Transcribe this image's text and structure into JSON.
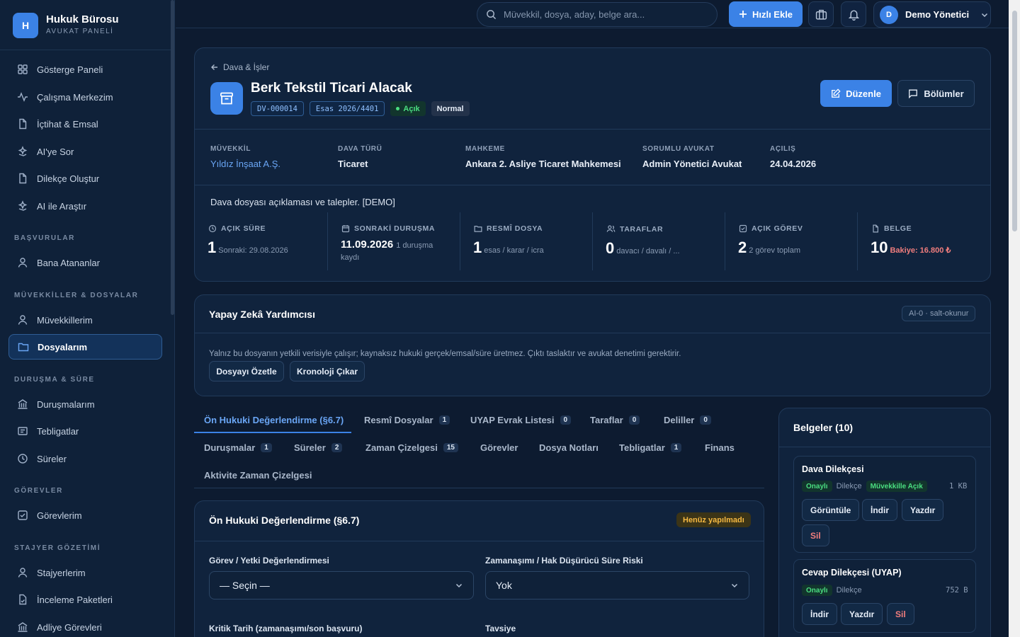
{
  "brand": {
    "logo": "H",
    "title": "Hukuk Bürosu",
    "subtitle": "AVUKAT PANELİ"
  },
  "sidebar": {
    "items": [
      {
        "label": "Gösterge Paneli",
        "icon": "grid-icon"
      },
      {
        "label": "Çalışma Merkezim",
        "icon": "activity-icon"
      },
      {
        "label": "İçtihat & Emsal",
        "icon": "file-icon"
      },
      {
        "label": "AI'ye Sor",
        "icon": "sparkle-icon"
      },
      {
        "label": "Dilekçe Oluştur",
        "icon": "file-icon"
      },
      {
        "label": "AI ile Araştır",
        "icon": "sparkle-icon"
      }
    ],
    "sections": [
      {
        "title": "BAŞVURULAR",
        "items": [
          {
            "label": "Bana Atananlar",
            "icon": "user-icon"
          }
        ]
      },
      {
        "title": "MÜVEKKİLLER & DOSYALAR",
        "items": [
          {
            "label": "Müvekkillerim",
            "icon": "user-icon"
          },
          {
            "label": "Dosyalarım",
            "icon": "folder-icon",
            "active": true
          }
        ]
      },
      {
        "title": "DURUŞMA & SÜRE",
        "items": [
          {
            "label": "Duruşmalarım",
            "icon": "courthouse-icon"
          },
          {
            "label": "Tebligatlar",
            "icon": "notice-icon"
          },
          {
            "label": "Süreler",
            "icon": "clock-icon"
          }
        ]
      },
      {
        "title": "GÖREVLER",
        "items": [
          {
            "label": "Görevlerim",
            "icon": "checkbox-icon"
          }
        ]
      },
      {
        "title": "STAJYER GÖZETİMİ",
        "items": [
          {
            "label": "Stajyerlerim",
            "icon": "user-icon"
          },
          {
            "label": "İnceleme Paketleri",
            "icon": "file-check-icon"
          },
          {
            "label": "Adliye Görevleri",
            "icon": "courthouse-icon"
          }
        ]
      }
    ]
  },
  "topbar": {
    "search_placeholder": "Müvekkil, dosya, aday, belge ara...",
    "quick_add": "Hızlı Ekle",
    "user_initial": "D",
    "user_name": "Demo Yönetici"
  },
  "case": {
    "breadcrumb": "Dava & İşler",
    "title": "Berk Tekstil Ticari Alacak",
    "code": "DV-000014",
    "esas": "Esas 2026/4401",
    "status": "Açık",
    "priority": "Normal",
    "edit_label": "Düzenle",
    "sections_label": "Bölümler",
    "info": [
      {
        "label": "MÜVEKKİL",
        "value": "Yıldız İnşaat A.Ş."
      },
      {
        "label": "DAVA TÜRÜ",
        "value": "Ticaret"
      },
      {
        "label": "MAHKEME",
        "value": "Ankara 2. Asliye Ticaret Mahkemesi"
      },
      {
        "label": "SORUMLU AVUKAT",
        "value": "Admin Yönetici Avukat"
      },
      {
        "label": "AÇILIŞ",
        "value": "24.04.2026"
      }
    ],
    "description": "Dava dosyası açıklaması ve talepler. [DEMO]",
    "stats": [
      {
        "label": "AÇIK SÜRE",
        "icon": "clock-icon",
        "value": "1",
        "sub": "Sonraki: 29.08.2026"
      },
      {
        "label": "SONRAKİ DURUŞMA",
        "icon": "calendar-icon",
        "value": "11.09.2026",
        "sub": "1 duruşma",
        "sub2": "kaydı"
      },
      {
        "label": "RESMÎ DOSYA",
        "icon": "folder-icon",
        "value": "1",
        "sub": "esas / karar / icra"
      },
      {
        "label": "TARAFLAR",
        "icon": "users-icon",
        "value": "0",
        "sub": "davacı / davalı / ..."
      },
      {
        "label": "AÇIK GÖREV",
        "icon": "checkbox-icon",
        "value": "2",
        "sub": "2 görev toplam"
      },
      {
        "label": "BELGE",
        "icon": "file-icon",
        "value": "10",
        "sub": "Bakiye: 16.800 ₺"
      }
    ]
  },
  "ai": {
    "title": "Yapay Zekâ Yardımcısı",
    "badge": "AI-0 · salt-okunur",
    "notice": "Yalnız bu dosyanın yetkili verisiyle çalışır; kaynaksız hukuki gerçek/emsal/süre üretmez. Çıktı taslaktır ve avukat denetimi gerektirir.",
    "btn_summary": "Dosyayı Özetle",
    "btn_chronology": "Kronoloji Çıkar"
  },
  "tabs": {
    "row1": [
      {
        "label": "Ön Hukuki Değerlendirme (§6.7)",
        "active": true
      },
      {
        "label": "Resmî Dosyalar",
        "count": "1"
      },
      {
        "label": "UYAP Evrak Listesi",
        "count": "0"
      },
      {
        "label": "Taraflar",
        "count": "0"
      },
      {
        "label": "Deliller",
        "count": "0"
      }
    ],
    "row2": [
      {
        "label": "Duruşmalar",
        "count": "1"
      },
      {
        "label": "Süreler",
        "count": "2"
      },
      {
        "label": "Zaman Çizelgesi",
        "count": "15"
      },
      {
        "label": "Görevler"
      },
      {
        "label": "Dosya Notları"
      },
      {
        "label": "Tebligatlar",
        "count": "1"
      },
      {
        "label": "Finans"
      }
    ],
    "row3": [
      {
        "label": "Aktivite Zaman Çizelgesi"
      }
    ]
  },
  "assessment": {
    "title": "Ön Hukuki Değerlendirme (§6.7)",
    "status": "Henüz yapılmadı",
    "f1_label": "Görev / Yetki Değerlendirmesi",
    "f1_value": "— Seçin —",
    "f2_label": "Zamanaşımı / Hak Düşürücü Süre Riski",
    "f2_value": "Yok",
    "f3_label": "Kritik Tarih (zamanaşımı/son başvuru)",
    "f4_label": "Tavsiye"
  },
  "documents": {
    "title": "Belgeler (10)",
    "items": [
      {
        "name": "Dava Dilekçesi",
        "status": "Onaylı",
        "type": "Dilekçe",
        "share": "Müvekkille Açık",
        "size": "1 KB",
        "actions": [
          "Görüntüle",
          "İndir",
          "Yazdır"
        ],
        "delete": "Sil"
      },
      {
        "name": "Cevap Dilekçesi (UYAP)",
        "status": "Onaylı",
        "type": "Dilekçe",
        "size": "752 B",
        "actions": [
          "İndir",
          "Yazdır"
        ],
        "delete": "Sil"
      }
    ]
  },
  "colors": {
    "accent": "#3b82e6",
    "success": "#22c55e",
    "warning": "#f5b942",
    "danger": "#f07d7d",
    "background": "#0d1b30"
  }
}
